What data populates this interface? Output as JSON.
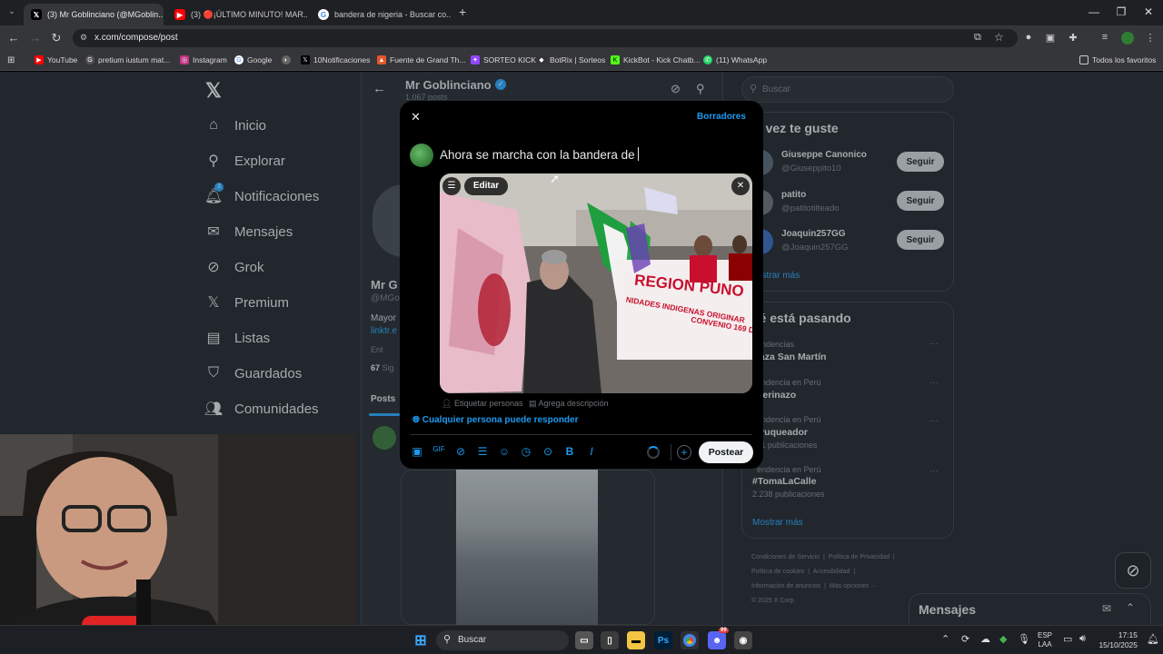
{
  "tabs": [
    {
      "title": "(3) Mr Goblinciano (@MGoblin...",
      "active": true
    },
    {
      "title": "(3) 🔴¡ÚLTIMO MINUTO! MAR...",
      "active": false
    },
    {
      "title": "bandera de nigeria - Buscar co...",
      "active": false
    }
  ],
  "address": {
    "url": "x.com/compose/post"
  },
  "bookmarks": [
    "YouTube",
    "pretium iustum mat...",
    "Instagram",
    "Google",
    "",
    "10Notificaciones",
    "Fuente de Grand Th...",
    "SORTEO KICK",
    "BotRix | Sorteos",
    "KickBot - Kick Chatb...",
    "(11) WhatsApp"
  ],
  "bookmarks_all": "Todos los favoritos",
  "sidebar": {
    "items": [
      {
        "label": "Inicio",
        "icon": "home-icon"
      },
      {
        "label": "Explorar",
        "icon": "search-icon"
      },
      {
        "label": "Notificaciones",
        "icon": "bell-icon"
      },
      {
        "label": "Mensajes",
        "icon": "mail-icon"
      },
      {
        "label": "Grok",
        "icon": "grok-icon"
      },
      {
        "label": "Premium",
        "icon": "x-icon"
      },
      {
        "label": "Listas",
        "icon": "list-icon"
      },
      {
        "label": "Guardados",
        "icon": "bookmark-icon"
      },
      {
        "label": "Comunidades",
        "icon": "people-icon"
      }
    ],
    "notification_badge": "3"
  },
  "profile": {
    "name": "Mr Goblinciano",
    "posts": "1.067 posts",
    "bg_name": "Mr G",
    "handle": "@MGo",
    "bio": "Mayor",
    "link": "linktr.e",
    "meta": "Ent",
    "following": "67",
    "following_label": "Sig",
    "tab_posts": "Posts"
  },
  "search": {
    "placeholder": "Buscar"
  },
  "who_to_follow": {
    "title": "al vez te guste",
    "users": [
      {
        "name": "Giuseppe Canonico",
        "handle": "@Giuseppito10"
      },
      {
        "name": "patito",
        "handle": "@patitotilteado"
      },
      {
        "name": "Joaquin257GG",
        "handle": "@Joaquin257GG"
      }
    ],
    "follow_label": "Seguir",
    "more": "ostrar más"
  },
  "trends": {
    "title": "ué está pasando",
    "items": [
      {
        "context": "endencias",
        "name": "laza San Martín",
        "count": ""
      },
      {
        "context": "endencia en Perú",
        "name": "nerinazo",
        "count": ""
      },
      {
        "context": "endencia en Perú",
        "name": "rruqueador",
        "count": "11 publicaciones"
      },
      {
        "context": "endencia en Perú",
        "name": "#TomaLaCalle",
        "count": "2.238 publicaciones"
      }
    ],
    "more": "Mostrar más"
  },
  "footer": {
    "l1a": "Condiciones de Servicio",
    "l1b": "Política de Privacidad",
    "l2a": "Política de cookies",
    "l2b": "Accesibilidad",
    "l3a": "Información de anuncios",
    "l3b": "Más opciones ···",
    "l4": "© 2025 X Corp."
  },
  "messages_dock": {
    "title": "Mensajes"
  },
  "compose": {
    "drafts": "Borradores",
    "text": "Ahora se marcha con la bandera de",
    "edit_label": "Editar",
    "tag_people": "Etiquetar personas",
    "add_description": "Agrega descripción",
    "reply_setting": "Cualquier persona puede responder",
    "post_button": "Postear"
  },
  "media": {
    "banner_text": "REGION PUNO",
    "banner_sub": "NIDADES INDIGENAS ORIGINAR",
    "banner_sub2": "CONVENIO 169 DE"
  },
  "taskbar": {
    "search": "Buscar",
    "lang1": "ESP",
    "lang2": "LAA",
    "time": "17:15",
    "date": "15/10/2025",
    "discord_badge": "99"
  },
  "colors": {
    "accent": "#1d9bf0",
    "bg": "#15181c",
    "modal": "#000000"
  }
}
